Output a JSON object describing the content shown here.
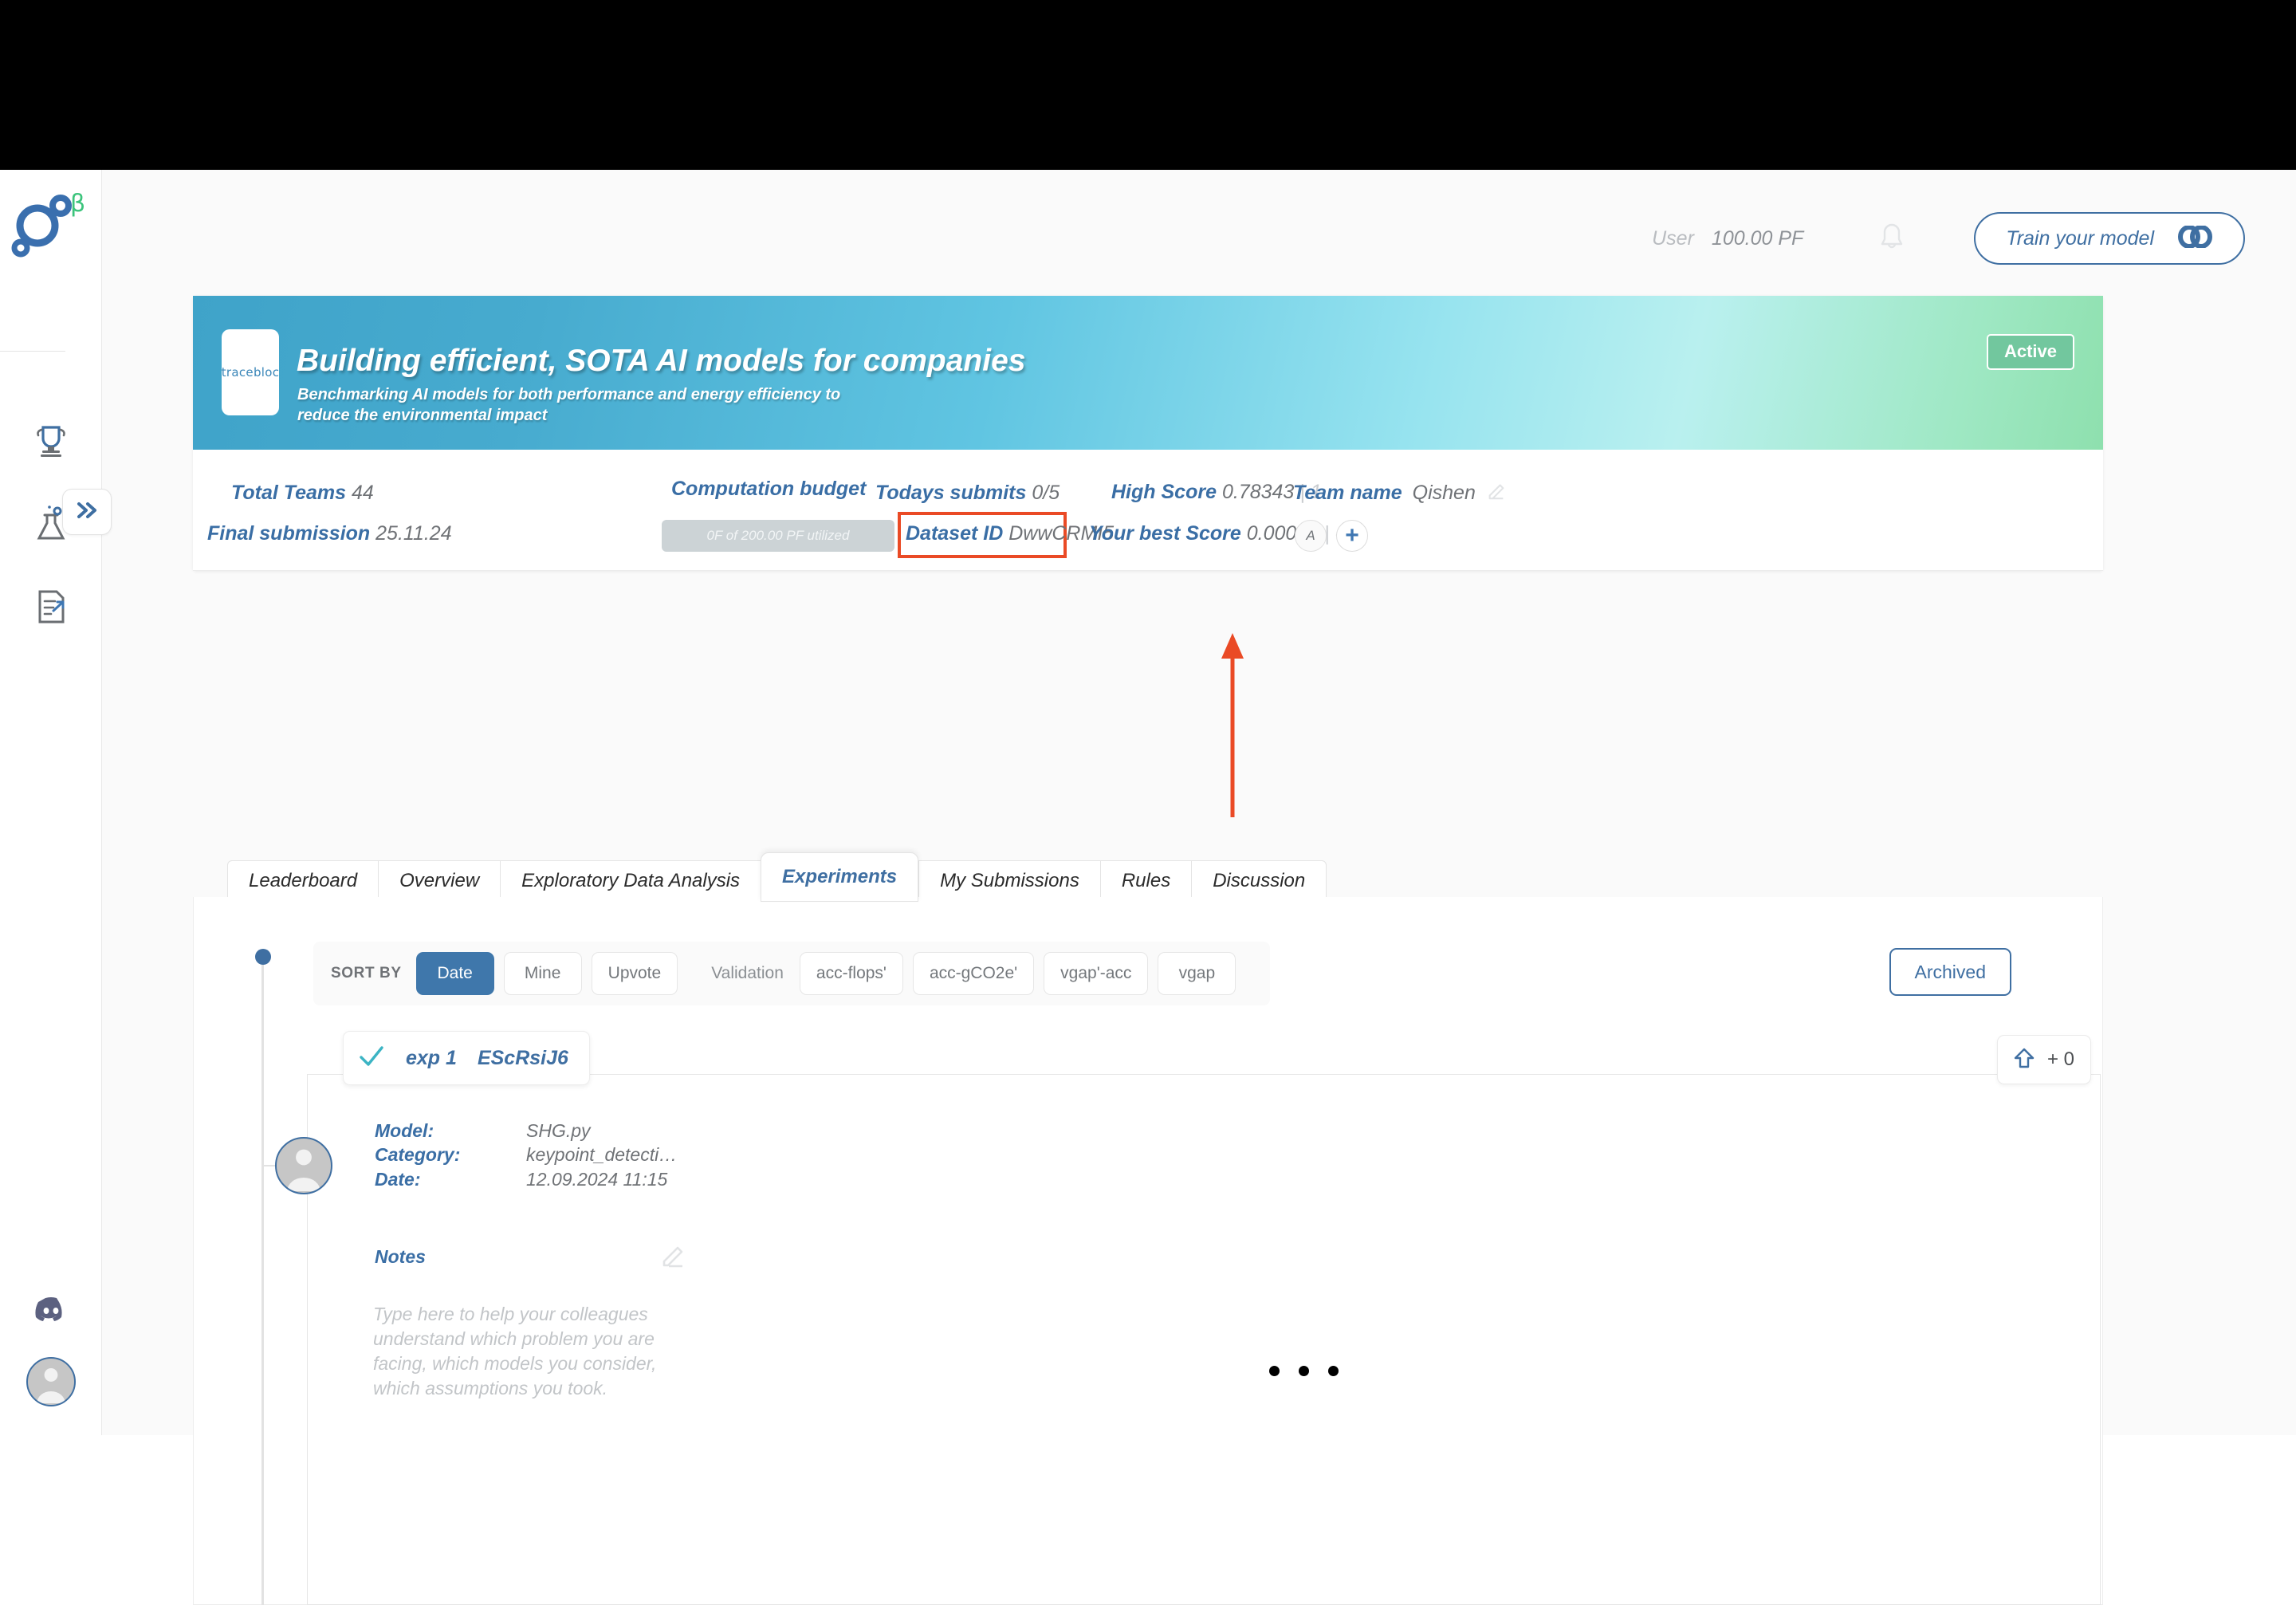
{
  "topbar": {
    "user_label": "User",
    "pf_value": "100.00 PF",
    "bell_icon": "bell-icon",
    "train_button": "Train your model",
    "colab_icon": "colab-icon"
  },
  "rail": {
    "logo_beta": "β",
    "collapse_icon": "chevron-double-right-icon",
    "items": [
      {
        "icon": "trophy-icon",
        "name": "competitions"
      },
      {
        "icon": "flask-icon",
        "name": "experiments"
      },
      {
        "icon": "document-export-icon",
        "name": "submissions"
      }
    ],
    "bottom": [
      {
        "icon": "discord-icon",
        "name": "discord"
      },
      {
        "icon": "avatar-icon",
        "name": "profile"
      }
    ]
  },
  "hero": {
    "logo_text": "tracebloc",
    "title": "Building efficient, SOTA AI models for companies",
    "subtitle_line1": "Benchmarking AI models for both performance and energy efficiency to",
    "subtitle_line2": "reduce the environmental impact",
    "status_badge": "Active",
    "gradient_from": "#3fa3c9",
    "gradient_to": "#8ee0ae",
    "badge_color": "#72c79e"
  },
  "stats": {
    "total_teams_label": "Total Teams",
    "total_teams_value": "44",
    "final_submission_label": "Final submission",
    "final_submission_value": "25.11.24",
    "computation_budget_label": "Computation budget",
    "computation_budget_bar": "0F of 200.00 PF utilized",
    "todays_submits_label": "Todays submits",
    "todays_submits_value": "0/5",
    "dataset_id_label": "Dataset ID",
    "dataset_id_value": "DwwCRMI5",
    "high_score_label": "High Score",
    "high_score_value": "0.78343",
    "high_score_rank": "| 1.",
    "your_best_label": "Your best Score",
    "your_best_value": "0.00000",
    "your_best_rank": "| -",
    "team_name_label": "Team name",
    "team_name_value": "Qishen",
    "team_edit_icon": "pencil-icon",
    "team_member_initial": "A",
    "team_add_label": "+",
    "highlight_color": "#ea4a25"
  },
  "tabs": [
    {
      "label": "Leaderboard",
      "active": false
    },
    {
      "label": "Overview",
      "active": false
    },
    {
      "label": "Exploratory Data Analysis",
      "active": false
    },
    {
      "label": "Experiments",
      "active": true
    },
    {
      "label": "My Submissions",
      "active": false
    },
    {
      "label": "Rules",
      "active": false
    },
    {
      "label": "Discussion",
      "active": false
    }
  ],
  "filters": {
    "sort_by_label": "SORT BY",
    "sort_options": [
      {
        "label": "Date",
        "selected": true
      },
      {
        "label": "Mine",
        "selected": false
      },
      {
        "label": "Upvote",
        "selected": false
      }
    ],
    "validation_label": "Validation",
    "validation_options": [
      {
        "label": "acc-flops'",
        "selected": false
      },
      {
        "label": "acc-gCO2e'",
        "selected": false
      },
      {
        "label": "vgap'-acc",
        "selected": false
      },
      {
        "label": "vgap",
        "selected": false
      }
    ],
    "archived_label": "Archived"
  },
  "experiment": {
    "check_icon": "check-icon",
    "title_prefix": "exp 1",
    "title_id": "EScRsiJ6",
    "upvote_icon": "upvote-arrow-icon",
    "upvote_count": "+ 0",
    "avatar_icon": "avatar-icon",
    "meta": [
      {
        "key": "Model:",
        "value": "SHG.py"
      },
      {
        "key": "Category:",
        "value": "keypoint_detecti…"
      },
      {
        "key": "Date:",
        "value": "12.09.2024 11:15"
      }
    ],
    "notes_label": "Notes",
    "notes_edit_icon": "pencil-icon",
    "notes_placeholder": "Type here to help your colleagues understand which problem you are facing, which models you consider, which assumptions you took.",
    "loading_indicator": "three-dots"
  }
}
